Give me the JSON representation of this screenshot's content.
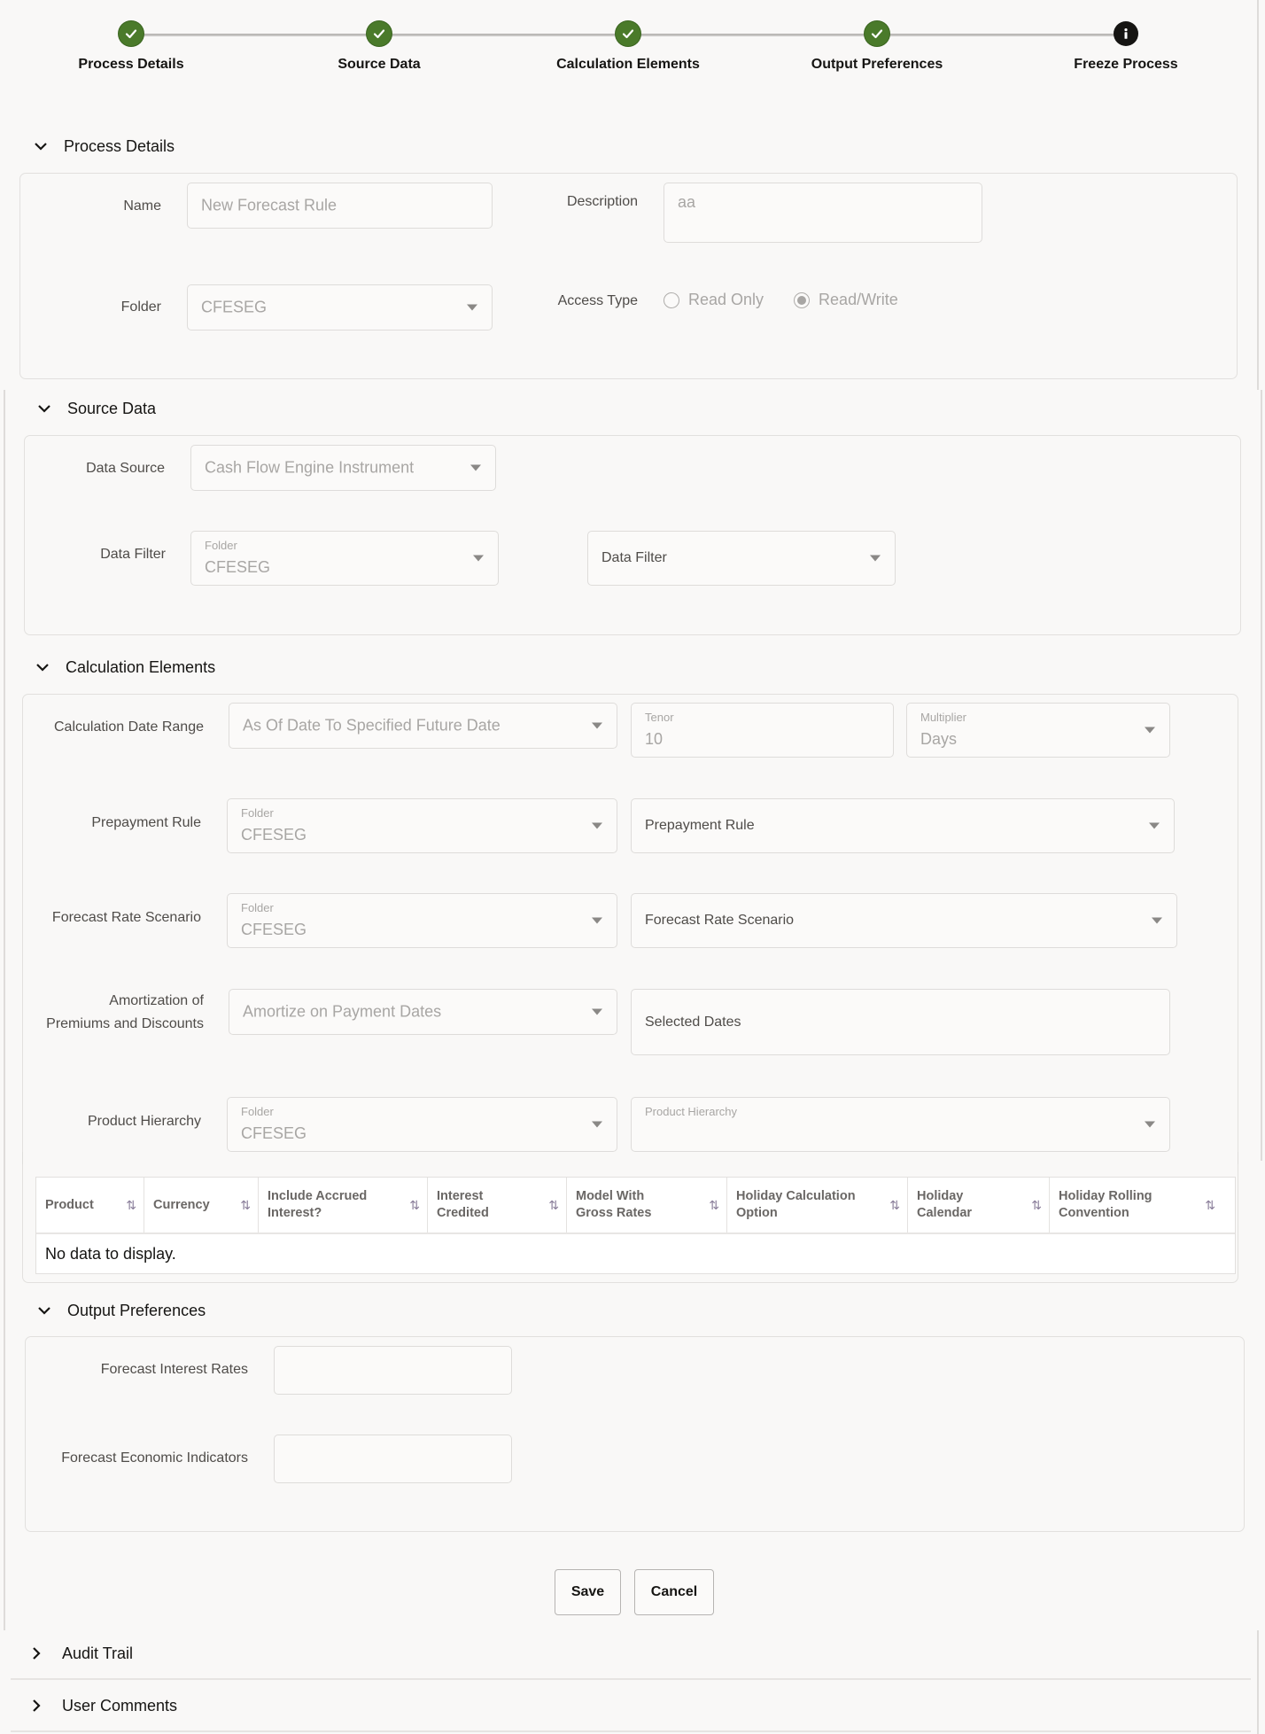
{
  "train": {
    "steps": [
      {
        "label": "Process Details",
        "status": "complete",
        "icon": "check-icon"
      },
      {
        "label": "Source Data",
        "status": "complete",
        "icon": "check-icon"
      },
      {
        "label": "Calculation Elements",
        "status": "complete",
        "icon": "check-icon"
      },
      {
        "label": "Output Preferences",
        "status": "complete",
        "icon": "check-icon"
      },
      {
        "label": "Freeze Process",
        "status": "current",
        "icon": "info-icon"
      }
    ]
  },
  "colors": {
    "complete": "#4a7a2a",
    "current": "#161513",
    "background": "#f9f8f7"
  },
  "process_details": {
    "title": "Process Details",
    "name_label": "Name",
    "name_value": "New Forecast Rule",
    "description_label": "Description",
    "description_value": "aa",
    "folder_label": "Folder",
    "folder_value": "CFESEG",
    "access_type_label": "Access Type",
    "access_options": [
      {
        "label": "Read Only",
        "selected": false
      },
      {
        "label": "Read/Write",
        "selected": true
      }
    ]
  },
  "source_data": {
    "title": "Source Data",
    "data_source_label": "Data Source",
    "data_source_value": "Cash Flow Engine Instrument",
    "data_filter_label": "Data Filter",
    "filter_folder_label": "Folder",
    "filter_folder_value": "CFESEG",
    "filter_select_placeholder": "Data Filter"
  },
  "calculation_elements": {
    "title": "Calculation Elements",
    "date_range_label": "Calculation Date Range",
    "date_range_value": "As Of Date To Specified Future Date",
    "tenor_label": "Tenor",
    "tenor_value": "10",
    "multiplier_label": "Multiplier",
    "multiplier_value": "Days",
    "prepayment_label": "Prepayment Rule",
    "prepayment_folder_label": "Folder",
    "prepayment_folder_value": "CFESEG",
    "prepayment_select_placeholder": "Prepayment Rule",
    "forecast_label": "Forecast Rate Scenario",
    "forecast_folder_label": "Folder",
    "forecast_folder_value": "CFESEG",
    "forecast_select_placeholder": "Forecast Rate Scenario",
    "amortization_label_line1": "Amortization of",
    "amortization_label_line2": "Premiums and Discounts",
    "amortization_value": "Amortize on Payment Dates",
    "selected_dates_placeholder": "Selected Dates",
    "product_hierarchy_label": "Product Hierarchy",
    "product_folder_label": "Folder",
    "product_folder_value": "CFESEG",
    "product_hierarchy_select_label": "Product Hierarchy",
    "table": {
      "columns": [
        {
          "line1": "Product",
          "line2": ""
        },
        {
          "line1": "Currency",
          "line2": ""
        },
        {
          "line1": "Include Accrued",
          "line2": "Interest?"
        },
        {
          "line1": "Interest",
          "line2": "Credited"
        },
        {
          "line1": "Model With",
          "line2": "Gross Rates"
        },
        {
          "line1": "Holiday Calculation",
          "line2": "Option"
        },
        {
          "line1": "Holiday",
          "line2": "Calendar"
        },
        {
          "line1": "Holiday Rolling",
          "line2": "Convention"
        }
      ],
      "sort_icon": "⇅",
      "empty_message": "No data to display."
    }
  },
  "output_preferences": {
    "title": "Output Preferences",
    "interest_rates_label": "Forecast Interest Rates",
    "interest_rates_value": "",
    "economic_indicators_label": "Forecast Economic Indicators",
    "economic_indicators_value": ""
  },
  "actions": {
    "save_label": "Save",
    "cancel_label": "Cancel"
  },
  "accordions": [
    {
      "label": "Audit Trail",
      "expanded": false
    },
    {
      "label": "User Comments",
      "expanded": false
    }
  ]
}
